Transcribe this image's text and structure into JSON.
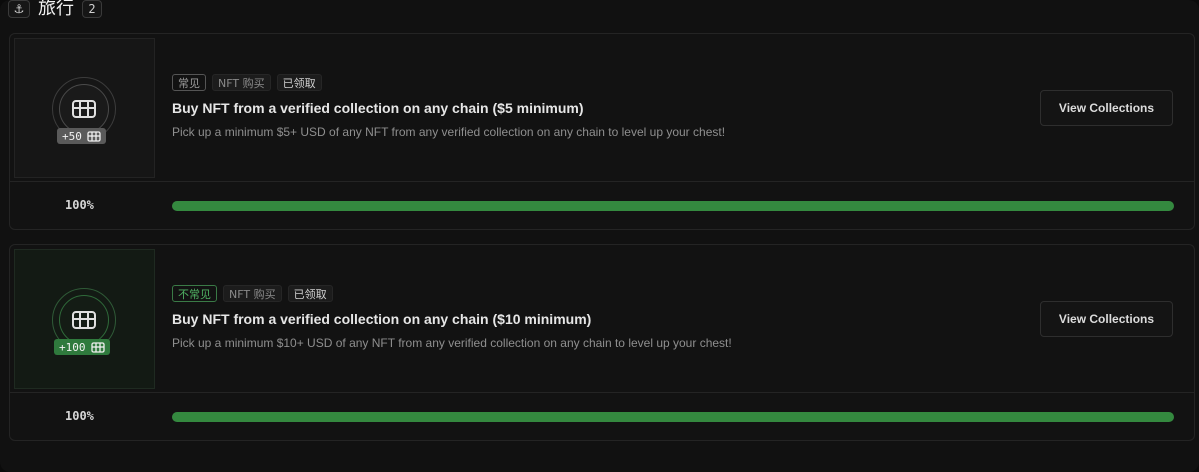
{
  "header": {
    "icon": "anchor-icon",
    "title": "旅行",
    "count": "2"
  },
  "quests": [
    {
      "reward": "+50",
      "rarity": "常见",
      "type": "NFT 购买",
      "status": "已领取",
      "title": "Buy NFT from a verified collection on any chain ($5 minimum)",
      "description": "Pick up a minimum $5+ USD of any NFT from any verified collection on any chain to level up your chest!",
      "button_label": "View Collections",
      "progress_label": "100%",
      "progress": 1.0
    },
    {
      "reward": "+100",
      "rarity": "不常见",
      "type": "NFT 购买",
      "status": "已领取",
      "title": "Buy NFT from a verified collection on any chain ($10 minimum)",
      "description": "Pick up a minimum $10+ USD of any NFT from any verified collection on any chain to level up your chest!",
      "button_label": "View Collections",
      "progress_label": "100%",
      "progress": 1.0
    }
  ],
  "colors": {
    "progress_fill": "#34893f",
    "uncommon_accent": "#4fb062"
  }
}
